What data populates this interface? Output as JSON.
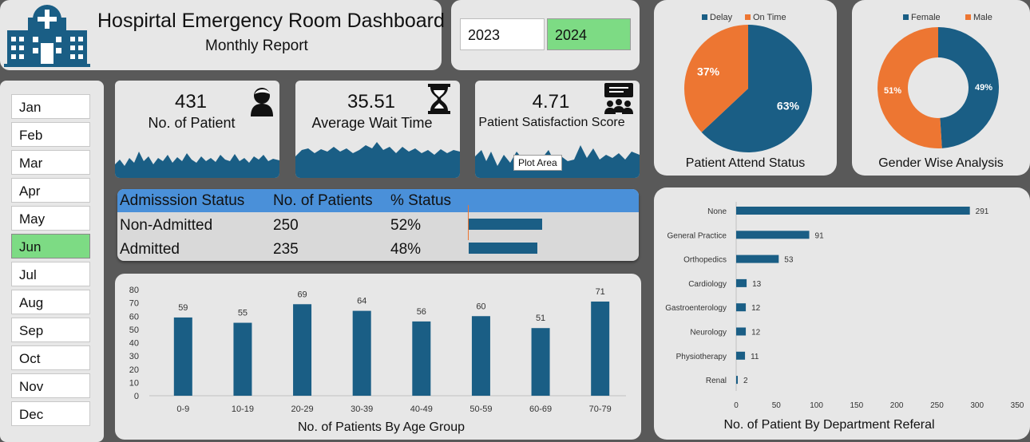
{
  "header": {
    "title": "Hospirtal Emergency Room Dashboard",
    "subtitle": "Monthly Report"
  },
  "years": [
    {
      "label": "2023",
      "selected": false
    },
    {
      "label": "2024",
      "selected": true
    }
  ],
  "months": [
    {
      "label": "Jan",
      "selected": false
    },
    {
      "label": "Feb",
      "selected": false
    },
    {
      "label": "Mar",
      "selected": false
    },
    {
      "label": "Apr",
      "selected": false
    },
    {
      "label": "May",
      "selected": false
    },
    {
      "label": "Jun",
      "selected": true
    },
    {
      "label": "Jul",
      "selected": false
    },
    {
      "label": "Aug",
      "selected": false
    },
    {
      "label": "Sep",
      "selected": false
    },
    {
      "label": "Oct",
      "selected": false
    },
    {
      "label": "Nov",
      "selected": false
    },
    {
      "label": "Dec",
      "selected": false
    }
  ],
  "kpis": [
    {
      "value": "431",
      "label": "No. of Patient",
      "icon": "patient-icon"
    },
    {
      "value": "35.51",
      "label": "Average Wait Time",
      "icon": "hourglass-icon"
    },
    {
      "value": "4.71",
      "label": "Patient Satisfaction Score",
      "icon": "feedback-icon"
    }
  ],
  "tooltip": {
    "text": "Plot Area"
  },
  "admission": {
    "headers": [
      "Admisssion Status",
      "No. of Patients",
      "% Status"
    ],
    "rows": [
      {
        "status": "Non-Admitted",
        "count": "250",
        "pct": "52%",
        "value": 250
      },
      {
        "status": "Admitted",
        "count": "235",
        "pct": "48%",
        "value": 235
      }
    ]
  },
  "colors": {
    "primary": "#1a5e85",
    "orange": "#ed7632",
    "green": "#7ddb84",
    "header_blue": "#4a90d9",
    "background": "#595959",
    "panel": "#e7e7e7"
  },
  "chart_data": [
    {
      "type": "pie",
      "title": "Patient Attend Status",
      "legend": "top",
      "slices": [
        {
          "name": "Delay",
          "value": 63,
          "label": "63%",
          "color": "#1a5e85"
        },
        {
          "name": "On Time",
          "value": 37,
          "label": "37%",
          "color": "#ed7632"
        }
      ]
    },
    {
      "type": "pie",
      "subtype": "donut",
      "title": "Gender Wise Analysis",
      "legend": "top",
      "slices": [
        {
          "name": "Female",
          "value": 49,
          "label": "49%",
          "color": "#1a5e85"
        },
        {
          "name": "Male",
          "value": 51,
          "label": "51%",
          "color": "#ed7632"
        }
      ]
    },
    {
      "type": "bar",
      "title": "No. of Patients By Age Group",
      "categories": [
        "0-9",
        "10-19",
        "20-29",
        "30-39",
        "40-49",
        "50-59",
        "60-69",
        "70-79"
      ],
      "values": [
        59,
        55,
        69,
        64,
        56,
        60,
        51,
        71
      ],
      "yticks": [
        "0",
        "10",
        "20",
        "30",
        "40",
        "50",
        "60",
        "70",
        "80"
      ],
      "ylim": [
        0,
        80
      ],
      "grid": false
    },
    {
      "type": "bar",
      "orientation": "horizontal",
      "title": "No. of Patient By Department Referal",
      "categories": [
        "None",
        "General Practice",
        "Orthopedics",
        "Cardiology",
        "Gastroenterology",
        "Neurology",
        "Physiotherapy",
        "Renal"
      ],
      "values": [
        291,
        91,
        53,
        13,
        12,
        12,
        11,
        2
      ],
      "xticks": [
        "0",
        "50",
        "100",
        "150",
        "200",
        "250",
        "300",
        "350"
      ],
      "xlim": [
        0,
        350
      ],
      "grid": false
    }
  ]
}
